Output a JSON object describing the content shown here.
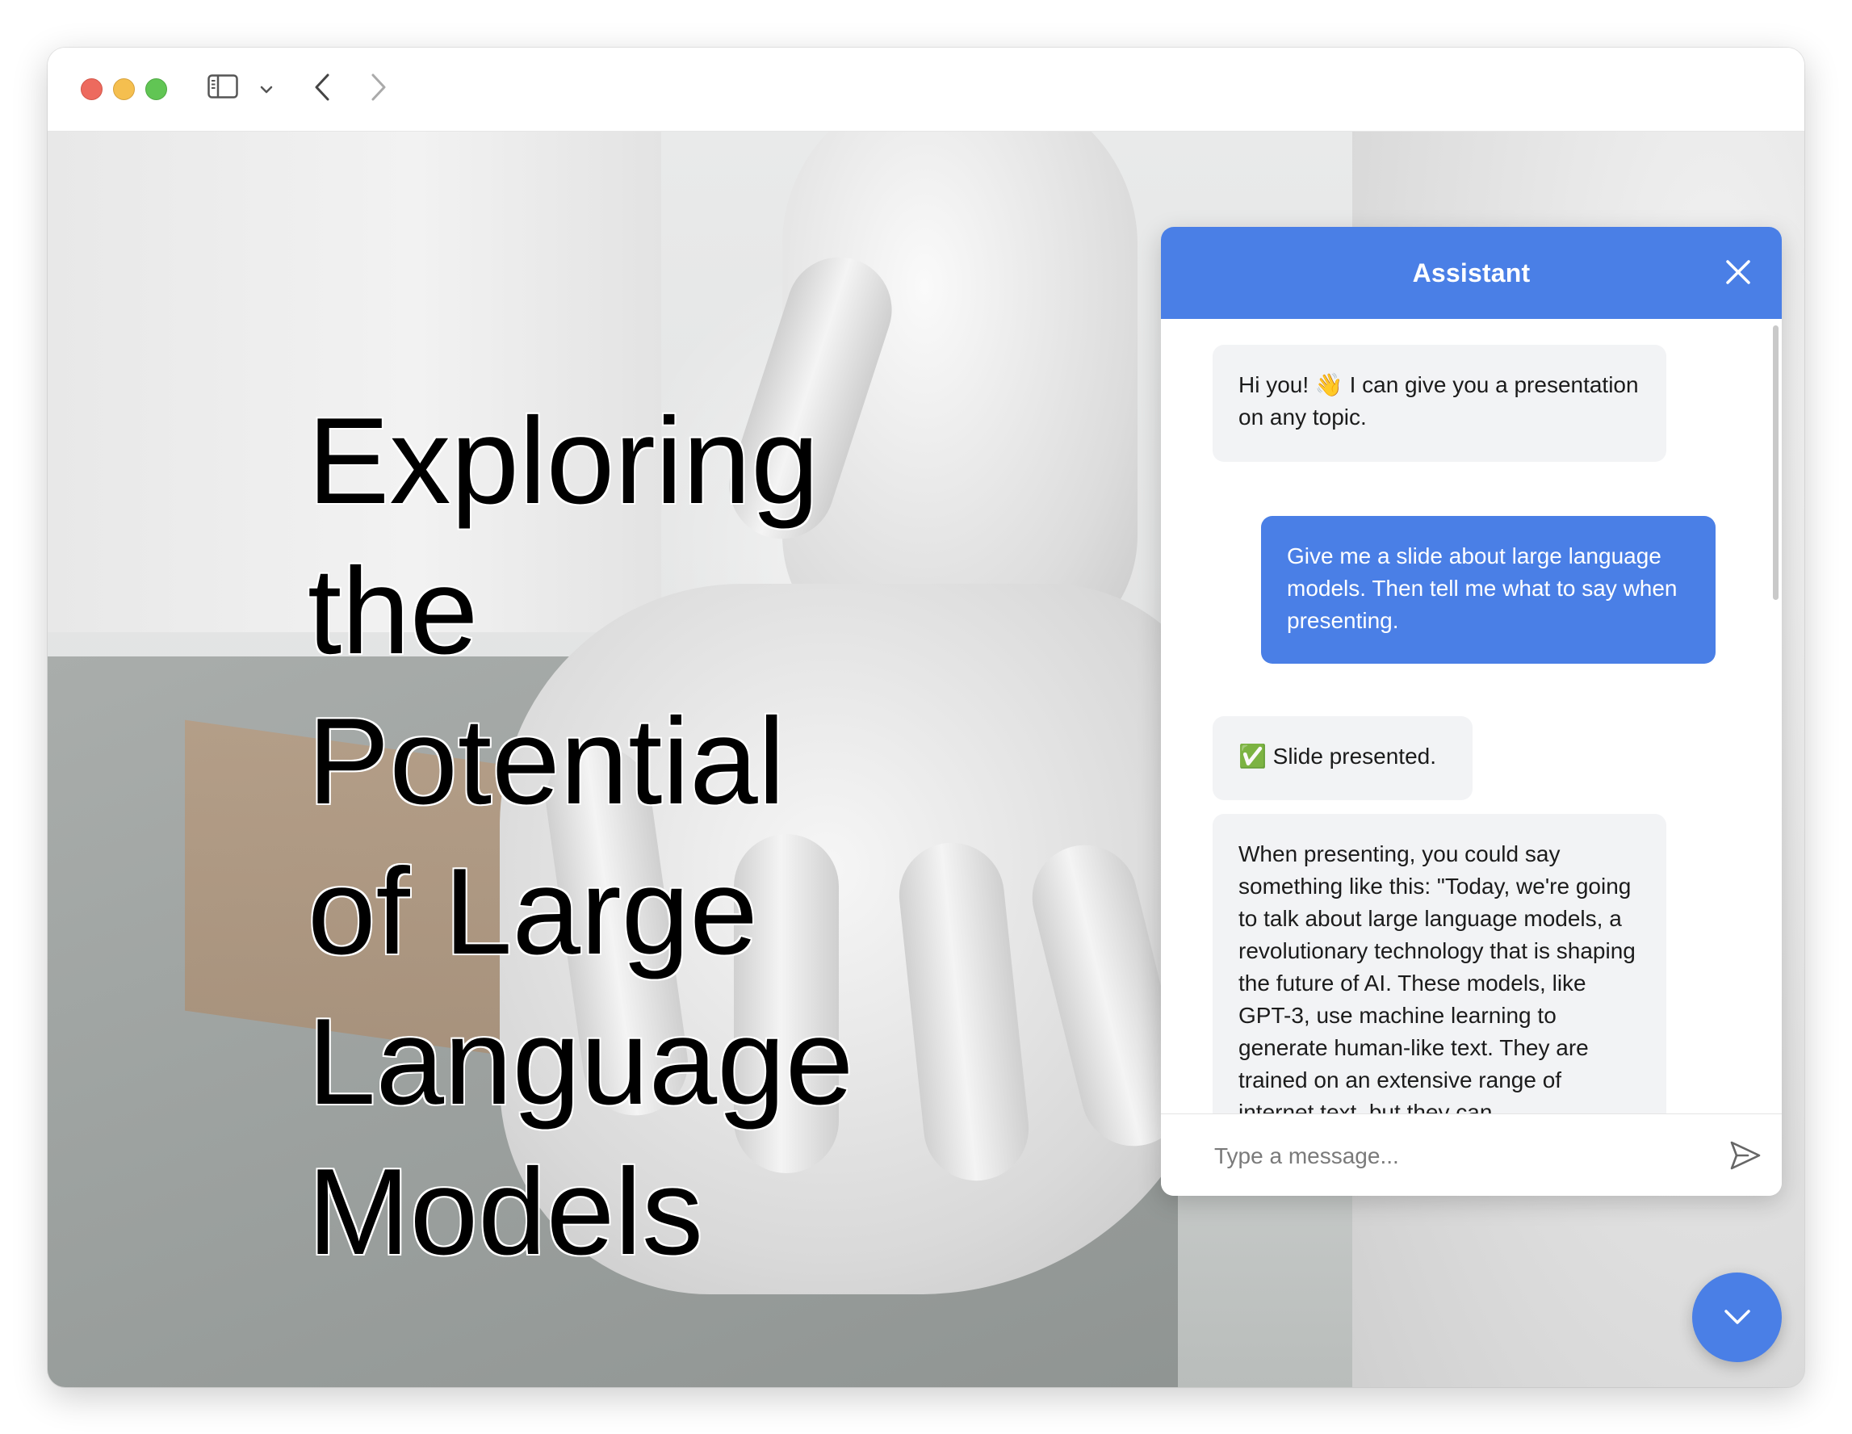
{
  "window": {
    "traffic_lights": [
      "close",
      "minimize",
      "zoom"
    ],
    "toolbar_icons": [
      "sidebar-icon",
      "chevron-down-icon",
      "back-icon",
      "forward-icon"
    ]
  },
  "slide": {
    "title": "Exploring the Potential of Large Language Models",
    "background": "robot hand photo"
  },
  "chat": {
    "header_title": "Assistant",
    "accent_color": "#4a7fe6",
    "messages": [
      {
        "role": "assistant",
        "text": "Hi you! 👋 I can give you a presentation on any topic."
      },
      {
        "role": "user",
        "text": "Give me a slide about large language models. Then tell me what to say when presenting."
      },
      {
        "role": "assistant",
        "text": "✅ Slide presented."
      },
      {
        "role": "assistant",
        "text": "When presenting, you could say something like this: \"Today, we're going to talk about large language models, a revolutionary technology that is shaping the future of AI. These models, like GPT-3, use machine learning to generate human-like text. They are trained on an extensive range of internet text, but they can"
      }
    ],
    "input_placeholder": "Type a message...",
    "send_icon": "send-icon"
  },
  "fab": {
    "icon": "chevron-down-icon"
  }
}
